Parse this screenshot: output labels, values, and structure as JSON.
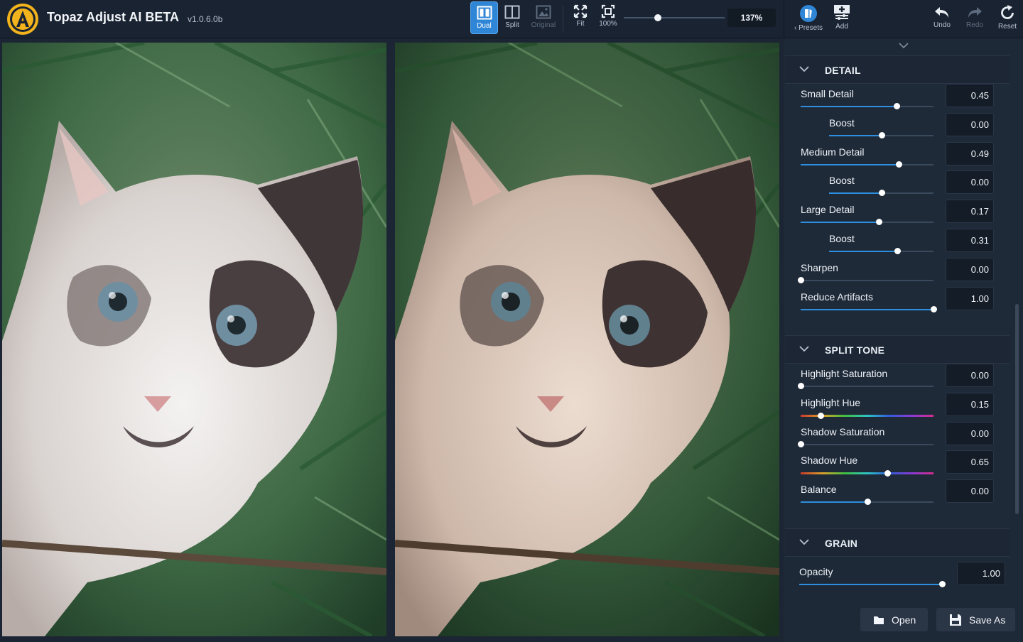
{
  "app": {
    "title": "Topaz Adjust AI BETA",
    "version": "v1.0.6.0b"
  },
  "view_modes": [
    {
      "label": "Dual",
      "state": "active"
    },
    {
      "label": "Split",
      "state": "normal"
    },
    {
      "label": "Original",
      "state": "disabled"
    }
  ],
  "zoom_buttons": [
    {
      "label": "Fit"
    },
    {
      "label": "100%"
    }
  ],
  "zoom": {
    "value": "137%",
    "slider_fraction": 0.3
  },
  "right_toolbar": {
    "presets": "Presets",
    "add": "Add",
    "undo": "Undo",
    "redo": "Redo",
    "reset": "Reset"
  },
  "sections": {
    "detail": {
      "title": "DETAIL",
      "sliders": [
        {
          "label": "Small Detail",
          "value": "0.45",
          "fraction": 0.72,
          "indent": false
        },
        {
          "label": "Boost",
          "value": "0.00",
          "fraction": 0.5,
          "indent": true
        },
        {
          "label": "Medium Detail",
          "value": "0.49",
          "fraction": 0.74,
          "indent": false
        },
        {
          "label": "Boost",
          "value": "0.00",
          "fraction": 0.5,
          "indent": true
        },
        {
          "label": "Large Detail",
          "value": "0.17",
          "fraction": 0.59,
          "indent": false
        },
        {
          "label": "Boost",
          "value": "0.31",
          "fraction": 0.65,
          "indent": true
        },
        {
          "label": "Sharpen",
          "value": "0.00",
          "fraction": 0.0,
          "indent": false
        },
        {
          "label": "Reduce Artifacts",
          "value": "1.00",
          "fraction": 1.0,
          "indent": false
        }
      ]
    },
    "split_tone": {
      "title": "SPLIT TONE",
      "sliders": [
        {
          "label": "Highlight Saturation",
          "value": "0.00",
          "fraction": 0.0,
          "hue": false
        },
        {
          "label": "Highlight Hue",
          "value": "0.15",
          "fraction": 0.15,
          "hue": true
        },
        {
          "label": "Shadow Saturation",
          "value": "0.00",
          "fraction": 0.0,
          "hue": false
        },
        {
          "label": "Shadow Hue",
          "value": "0.65",
          "fraction": 0.65,
          "hue": true
        },
        {
          "label": "Balance",
          "value": "0.00",
          "fraction": 0.5,
          "hue": false
        }
      ]
    },
    "grain": {
      "title": "GRAIN",
      "sliders": [
        {
          "label": "Opacity",
          "value": "1.00",
          "fraction": 1.0
        }
      ]
    }
  },
  "footer": {
    "open": "Open",
    "save_as": "Save As"
  },
  "colors": {
    "accent": "#2f86d6",
    "slider_fill": "#2e8fe0",
    "background": "#1b2533",
    "logo": "#f2b31c"
  }
}
